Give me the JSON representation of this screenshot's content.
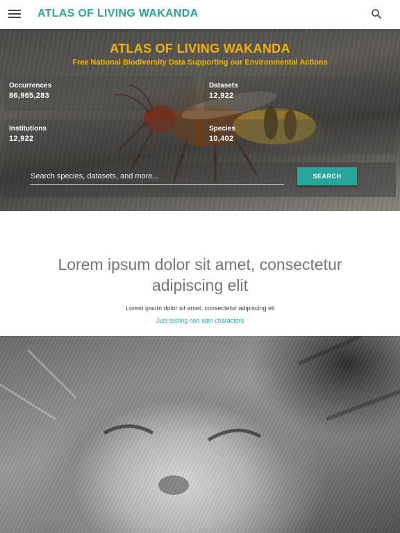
{
  "appbar": {
    "title": "ATLAS OF LIVING WAKANDA",
    "menu_icon": "menu-icon",
    "search_icon": "search-icon"
  },
  "hero": {
    "title": "ATLAS OF LIVING WAKANDA",
    "subtitle": "Free National Biodiversity Data Supporting our Environmental Actions",
    "stats": [
      {
        "label": "Occurrences",
        "value": "86,965,283"
      },
      {
        "label": "Datasets",
        "value": "12,922"
      },
      {
        "label": "Institutions",
        "value": "12,922"
      },
      {
        "label": "Species",
        "value": "10,402"
      }
    ],
    "search": {
      "placeholder": "Search species, datasets, and more...",
      "button_label": "SEARCH"
    }
  },
  "content": {
    "heading": "Lorem ipsum dolor sit amet, consectetur adipiscing elit",
    "paragraph": "Lorem ipsum dolor sit amet, consectetur adipiscing eli",
    "link": "Just testing non latin characters"
  },
  "colors": {
    "accent": "#2aa59a",
    "hero_text": "#f2b400"
  }
}
